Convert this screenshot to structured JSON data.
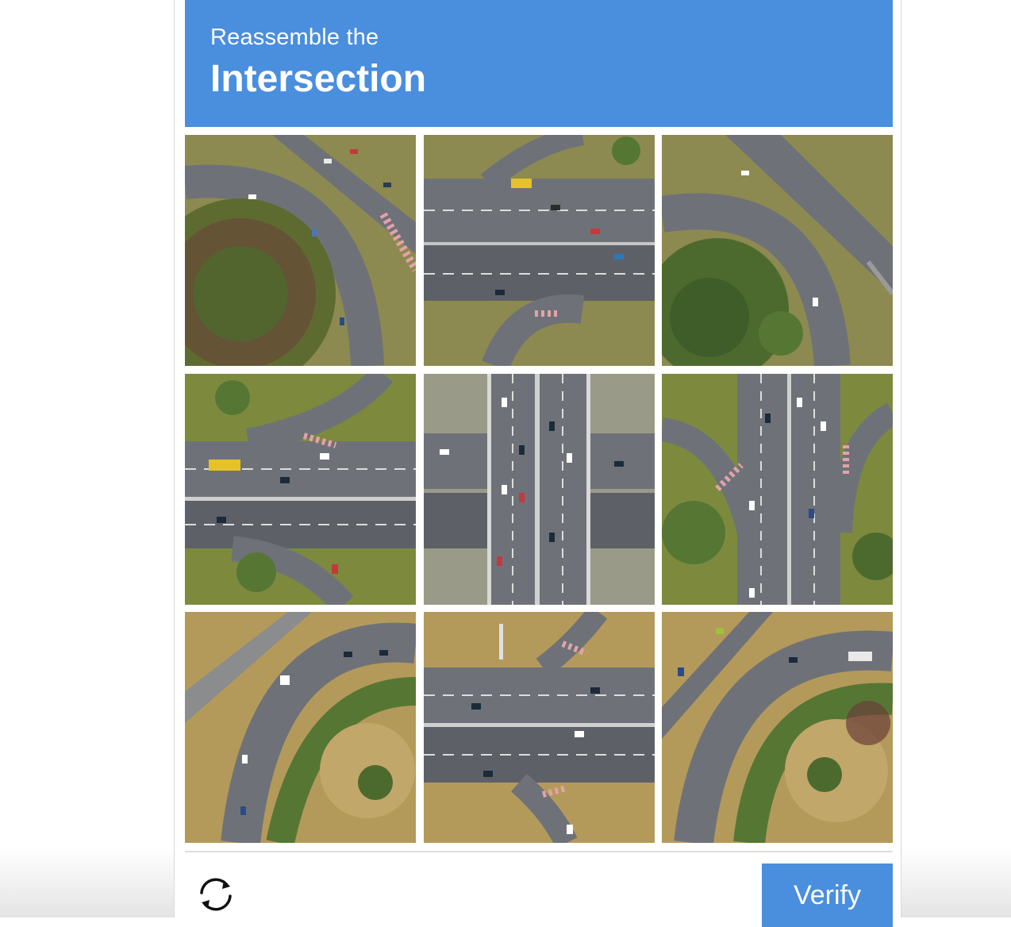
{
  "challenge": {
    "instruction": "Reassemble the",
    "target": "Intersection"
  },
  "tiles": [
    {
      "name": "tile-1-1",
      "description": "roundabout-garden-northwest"
    },
    {
      "name": "tile-1-2",
      "description": "highway-north-edge"
    },
    {
      "name": "tile-1-3",
      "description": "roundabout-northeast"
    },
    {
      "name": "tile-2-1",
      "description": "highway-west-junction"
    },
    {
      "name": "tile-2-2",
      "description": "overpass-center"
    },
    {
      "name": "tile-2-3",
      "description": "highway-east-junction"
    },
    {
      "name": "tile-3-1",
      "description": "roundabout-southwest"
    },
    {
      "name": "tile-3-2",
      "description": "highway-south-edge"
    },
    {
      "name": "tile-3-3",
      "description": "roundabout-southeast"
    }
  ],
  "footer": {
    "reload_icon": "reload-icon",
    "verify_label": "Verify"
  },
  "colors": {
    "accent": "#4a8ede",
    "road": "#6e7278",
    "grass": "#7d8a3e",
    "dry_grass": "#b49a5a"
  }
}
